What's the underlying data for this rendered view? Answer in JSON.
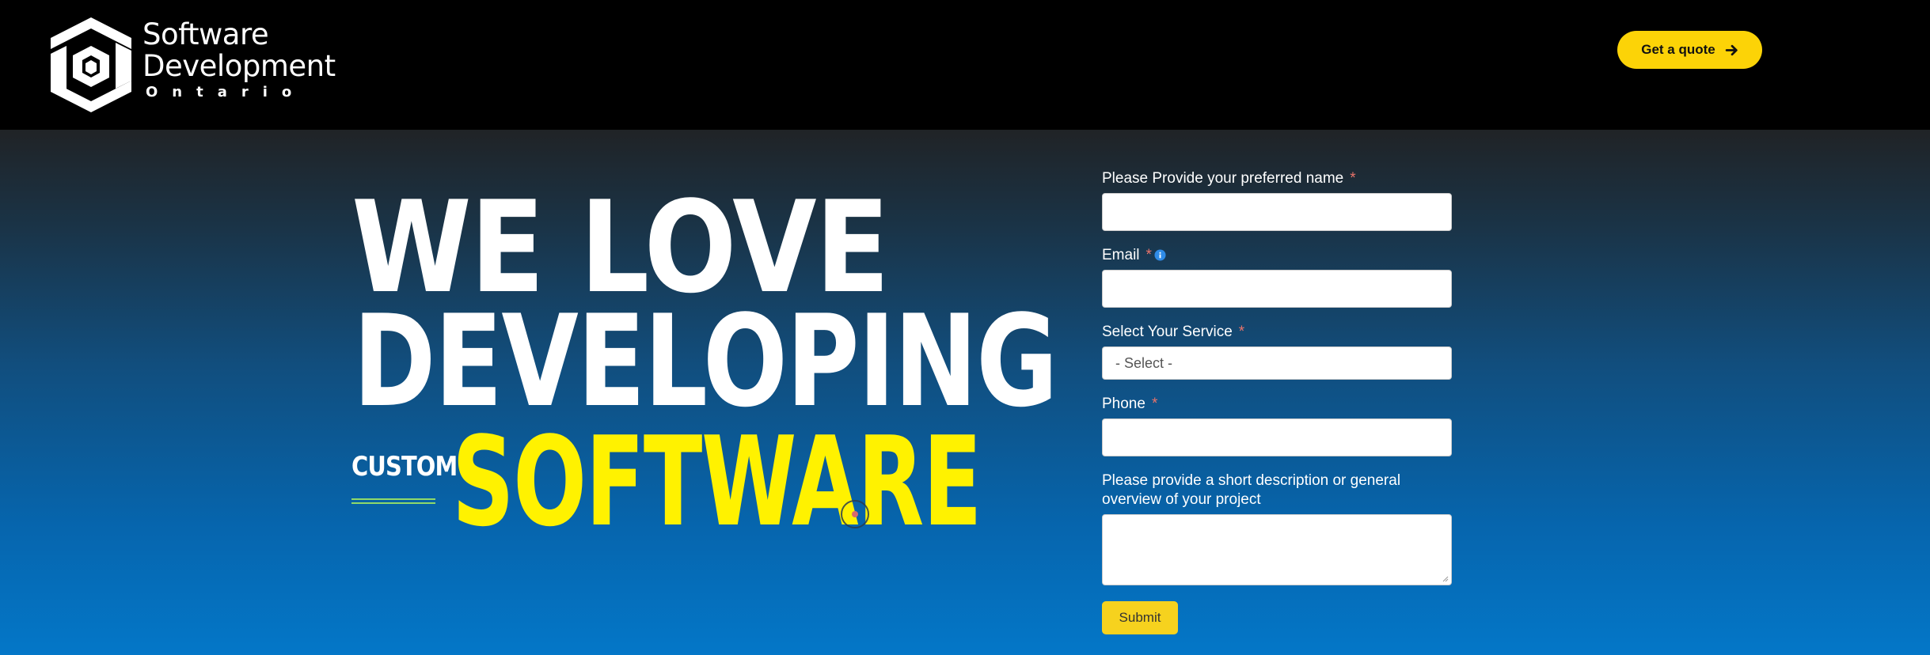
{
  "header": {
    "logo": {
      "line1": "Software",
      "line2": "Development",
      "line3": "Ontario"
    },
    "quote_button": {
      "label": "Get a quote",
      "icon": "arrow-right-icon"
    }
  },
  "hero": {
    "headline_line1": "WE LOVE",
    "headline_line2": "DEVELOPING",
    "custom_label": "CUSTOM",
    "headline_accent": "SOFTWARE"
  },
  "form": {
    "fields": [
      {
        "label": "Please Provide your preferred name",
        "required": "*",
        "value": ""
      },
      {
        "label": "Email",
        "required": "*",
        "value": "",
        "icon": "info-icon"
      },
      {
        "label": "Select Your Service",
        "required": "*",
        "selected": "- Select -"
      },
      {
        "label": "Phone",
        "required": "*",
        "value": ""
      },
      {
        "label": "Please provide a short description or general",
        "label_line2": "overview of your project",
        "value": ""
      }
    ],
    "submit_label": "Submit"
  },
  "colors": {
    "header_bg": "#000000",
    "accent_yellow": "#fcd307",
    "headline_yellow": "#fff200",
    "required_red": "#e8736a",
    "info_blue": "#2f8be6",
    "hero_top": "#202326",
    "hero_bottom": "#0477c8"
  }
}
